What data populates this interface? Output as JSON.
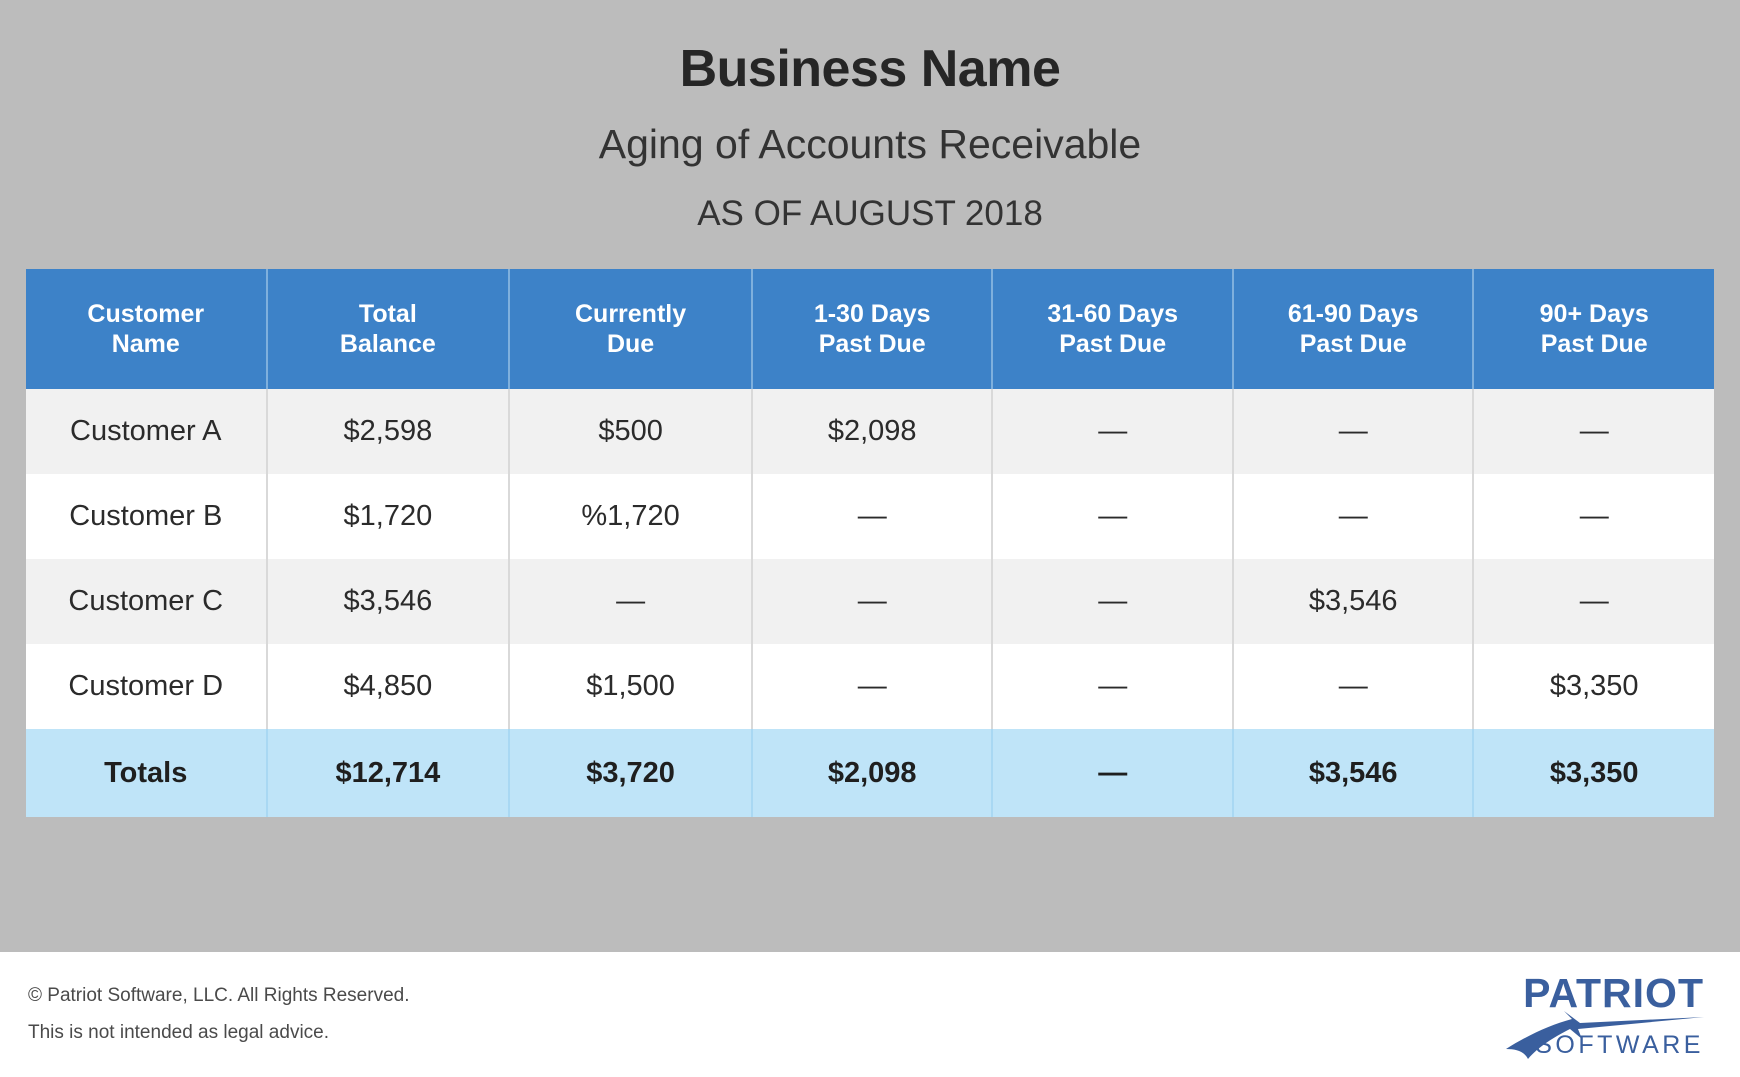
{
  "header": {
    "business_name": "Business Name",
    "report_title": "Aging of Accounts Receivable",
    "as_of": "AS OF AUGUST 2018"
  },
  "colors": {
    "background": "#bcbcbc",
    "header_blue": "#3d82c8",
    "totals_blue": "#bfe4f8",
    "row_alt": "#f1f1f1",
    "row_base": "#ffffff",
    "logo_blue": "#3a5f9e"
  },
  "table": {
    "columns": [
      {
        "line1": "Customer",
        "line2": "Name"
      },
      {
        "line1": "Total",
        "line2": "Balance"
      },
      {
        "line1": "Currently",
        "line2": "Due"
      },
      {
        "line1": "1-30 Days",
        "line2": "Past Due"
      },
      {
        "line1": "31-60 Days",
        "line2": "Past Due"
      },
      {
        "line1": "61-90 Days",
        "line2": "Past Due"
      },
      {
        "line1": "90+ Days",
        "line2": "Past Due"
      }
    ],
    "rows": [
      {
        "cells": [
          "Customer A",
          "$2,598",
          "$500",
          "$2,098",
          "—",
          "—",
          "—"
        ]
      },
      {
        "cells": [
          "Customer B",
          "$1,720",
          "%1,720",
          "—",
          "—",
          "—",
          "—"
        ]
      },
      {
        "cells": [
          "Customer C",
          "$3,546",
          "—",
          "—",
          "—",
          "$3,546",
          "—"
        ]
      },
      {
        "cells": [
          "Customer D",
          "$4,850",
          "$1,500",
          "—",
          "—",
          "—",
          "$3,350"
        ]
      }
    ],
    "totals": {
      "cells": [
        "Totals",
        "$12,714",
        "$3,720",
        "$2,098",
        "—",
        "$3,546",
        "$3,350"
      ]
    }
  },
  "footer": {
    "copyright": "© Patriot Software, LLC. All Rights Reserved.",
    "disclaimer": "This is not intended as legal advice.",
    "logo": {
      "wordmark": "PATRIOT",
      "subword": "SOFTWARE"
    }
  }
}
